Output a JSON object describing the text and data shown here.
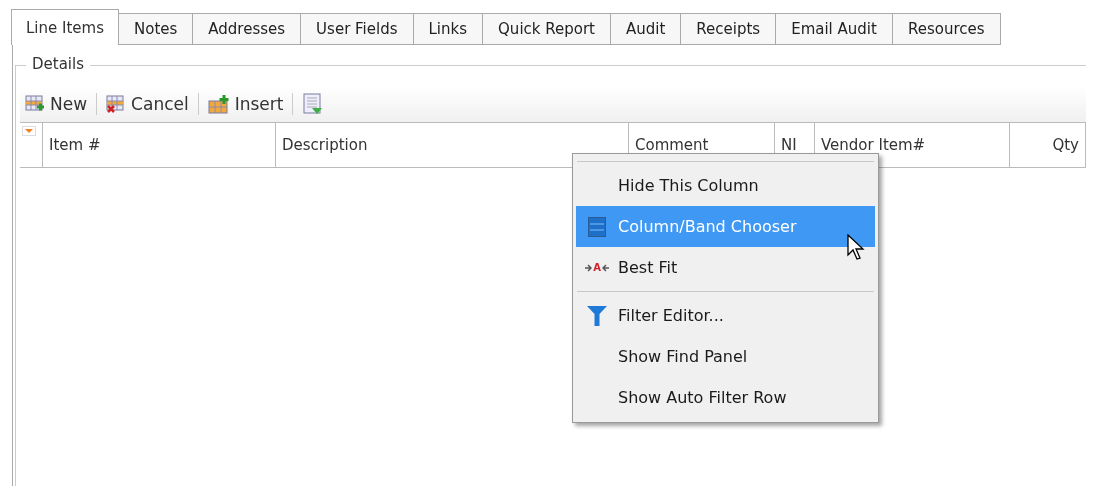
{
  "tabs": [
    {
      "label": "Line Items",
      "selected": true
    },
    {
      "label": "Notes",
      "selected": false
    },
    {
      "label": "Addresses",
      "selected": false
    },
    {
      "label": "User Fields",
      "selected": false
    },
    {
      "label": "Links",
      "selected": false
    },
    {
      "label": "Quick Report",
      "selected": false
    },
    {
      "label": "Audit",
      "selected": false
    },
    {
      "label": "Receipts",
      "selected": false
    },
    {
      "label": "Email Audit",
      "selected": false
    },
    {
      "label": "Resources",
      "selected": false
    }
  ],
  "group": {
    "title": "Details"
  },
  "toolbar": [
    {
      "kind": "new",
      "label": "New"
    },
    {
      "kind": "cancel",
      "label": "Cancel"
    },
    {
      "kind": "insert",
      "label": "Insert"
    },
    {
      "kind": "export"
    }
  ],
  "grid": {
    "columns": [
      {
        "label": "Item #"
      },
      {
        "label": "Description"
      },
      {
        "label": "Comment"
      },
      {
        "label": "NI"
      },
      {
        "label": "Vendor Item#"
      },
      {
        "label": "Qty"
      }
    ]
  },
  "context_menu": {
    "groups": [
      [
        {
          "kind": "plain",
          "label": "Hide This Column",
          "selected": false
        },
        {
          "kind": "columns",
          "label": "Column/Band Chooser",
          "selected": true
        },
        {
          "kind": "fit",
          "label": "Best Fit",
          "icon_text": "A",
          "selected": false
        }
      ],
      [
        {
          "kind": "filter",
          "label": "Filter Editor...",
          "selected": false
        },
        {
          "kind": "plain",
          "label": "Show Find Panel",
          "selected": false
        },
        {
          "kind": "plain",
          "label": "Show Auto Filter Row",
          "selected": false
        }
      ]
    ]
  }
}
